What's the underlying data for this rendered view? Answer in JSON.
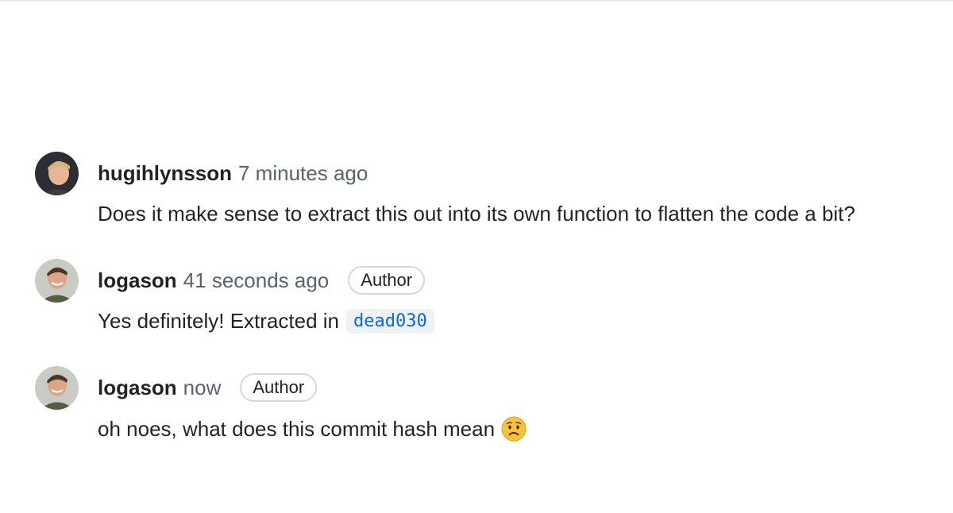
{
  "comments": [
    {
      "author": "hugihlynsson",
      "time": "7 minutes ago",
      "body": "Does it make sense to extract this out into its own function to flatten the code a bit?"
    },
    {
      "author": "logason",
      "time": "41 seconds ago",
      "badge": "Author",
      "body_prefix": "Yes definitely! Extracted in",
      "commit": "dead030"
    },
    {
      "author": "logason",
      "time": "now",
      "badge": "Author",
      "body": "oh noes, what does this commit hash mean",
      "emoji": "worried-face"
    }
  ],
  "colors": {
    "text": "#1f2328",
    "muted": "#59636e",
    "link": "#0969da",
    "badge_border": "#d1d9e0",
    "code_bg": "#eff2f5"
  }
}
